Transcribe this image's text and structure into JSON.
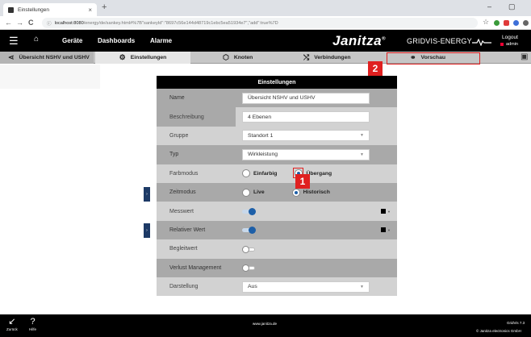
{
  "browser": {
    "tab_title": "Einstellungen",
    "tab_close": "×",
    "new_tab": "+",
    "url_host": "localhost:8080",
    "url_path": "/energy/de/sankey.html#%7B\"sankeyId\":\"8697c56e144d48719c1ebc5ea51934e7\",\"add\":true%7D",
    "back": "←",
    "forward": "→",
    "reload": "C",
    "star": "☆",
    "minimize": "–",
    "maximize": "▢"
  },
  "app_header": {
    "menu_icon": "☰",
    "home_icon": "⌂",
    "nav": [
      "Geräte",
      "Dashboards",
      "Alarme"
    ],
    "brand": "Janitza",
    "brand_mark": "®",
    "product": "GRIDVIS-ENERGY",
    "logout": "Logout",
    "user": "admin"
  },
  "subbar": {
    "back_label": "Übersicht NSHV und USHV",
    "settings_label": "Einstellungen",
    "nodes_label": "Knoten",
    "connections_label": "Verbindungen",
    "preview_label": "Vorschau"
  },
  "panel": {
    "title": "Einstellungen",
    "name_label": "Name",
    "name_value": "Übersicht NSHV und USHV",
    "desc_label": "Beschreibung",
    "desc_value": "4 Ebenen",
    "group_label": "Gruppe",
    "group_value": "Standort 1",
    "type_label": "Typ",
    "type_value": "Wirkleistung",
    "color_mode_label": "Farbmodus",
    "color_opt1": "Einfarbig",
    "color_opt2": "Übergang",
    "time_mode_label": "Zeitmodus",
    "time_opt1": "Live",
    "time_opt2": "Historisch",
    "measured_label": "Messwert",
    "relative_label": "Relativer Wert",
    "ref_label": "Begleitwert",
    "loss_label": "Verlust Management",
    "display_label": "Darstellung",
    "display_value": "Aus"
  },
  "badges": {
    "one": "1",
    "two": "2"
  },
  "footer": {
    "back_label": "Zurück",
    "help_label": "Hilfe",
    "site": "www.janitza.de",
    "version": "GridVis 7.3",
    "copyright": "© Janitza electronics GmbH"
  },
  "colors": {
    "accent": "#1d5fa8",
    "highlight": "#e02020",
    "header": "#000000"
  }
}
